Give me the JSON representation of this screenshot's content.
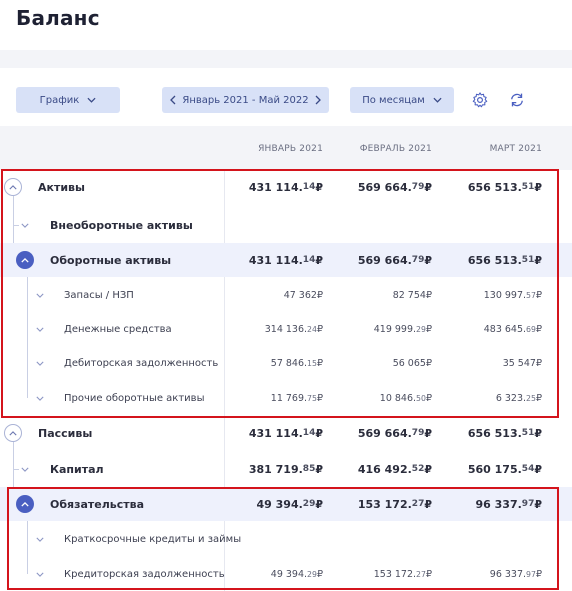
{
  "page": {
    "title": "Баланс"
  },
  "toolbar": {
    "chart_button": "График",
    "period_label": "Январь 2021 - Май 2022",
    "grouping_label": "По месяцам",
    "settings_icon": "gear-icon",
    "refresh_icon": "sync-icon"
  },
  "columns": [
    "ЯНВАРЬ 2021",
    "ФЕВРАЛЬ 2021",
    "МАРТ 2021"
  ],
  "rows": [
    {
      "label": "Активы",
      "values": [
        [
          "431 114.",
          "14",
          " ₽"
        ],
        [
          "569 664.",
          "79",
          " ₽"
        ],
        [
          "656 513.",
          "51",
          " ₽"
        ]
      ]
    },
    {
      "label": "Внеоборотные активы",
      "values": []
    },
    {
      "label": "Оборотные активы",
      "values": [
        [
          "431 114.",
          "14",
          " ₽"
        ],
        [
          "569 664.",
          "79",
          " ₽"
        ],
        [
          "656 513.",
          "51",
          " ₽"
        ]
      ]
    },
    {
      "label": "Запасы / НЗП",
      "values": [
        [
          "47 362",
          "",
          " ₽"
        ],
        [
          "82 754",
          "",
          " ₽"
        ],
        [
          "130 997.",
          "57",
          " ₽"
        ]
      ]
    },
    {
      "label": "Денежные средства",
      "values": [
        [
          "314 136.",
          "24",
          " ₽"
        ],
        [
          "419 999.",
          "29",
          " ₽"
        ],
        [
          "483 645.",
          "69",
          " ₽"
        ]
      ]
    },
    {
      "label": "Дебиторская задолженность",
      "values": [
        [
          "57 846.",
          "15",
          " ₽"
        ],
        [
          "56 065",
          "",
          " ₽"
        ],
        [
          "35 547",
          "",
          " ₽"
        ]
      ]
    },
    {
      "label": "Прочие оборотные активы",
      "values": [
        [
          "11 769.",
          "75",
          " ₽"
        ],
        [
          "10 846.",
          "50",
          " ₽"
        ],
        [
          "6 323.",
          "25",
          " ₽"
        ]
      ]
    },
    {
      "label": "Пассивы",
      "values": [
        [
          "431 114.",
          "14",
          " ₽"
        ],
        [
          "569 664.",
          "79",
          " ₽"
        ],
        [
          "656 513.",
          "51",
          " ₽"
        ]
      ]
    },
    {
      "label": "Капитал",
      "values": [
        [
          "381 719.",
          "85",
          " ₽"
        ],
        [
          "416 492.",
          "52",
          " ₽"
        ],
        [
          "560 175.",
          "54",
          " ₽"
        ]
      ]
    },
    {
      "label": "Обязательства",
      "values": [
        [
          "49 394.",
          "29",
          " ₽"
        ],
        [
          "153 172.",
          "27",
          " ₽"
        ],
        [
          "96 337.",
          "97",
          " ₽"
        ]
      ]
    },
    {
      "label": "Краткосрочные кредиты и займы",
      "values": []
    },
    {
      "label": "Кредиторская задолженность",
      "values": [
        [
          "49 394.",
          "29",
          " ₽"
        ],
        [
          "153 172.",
          "27",
          " ₽"
        ],
        [
          "96 337.",
          "97",
          " ₽"
        ]
      ]
    }
  ],
  "accent": "#4a5fc1",
  "highlight_color": "#d4141c"
}
